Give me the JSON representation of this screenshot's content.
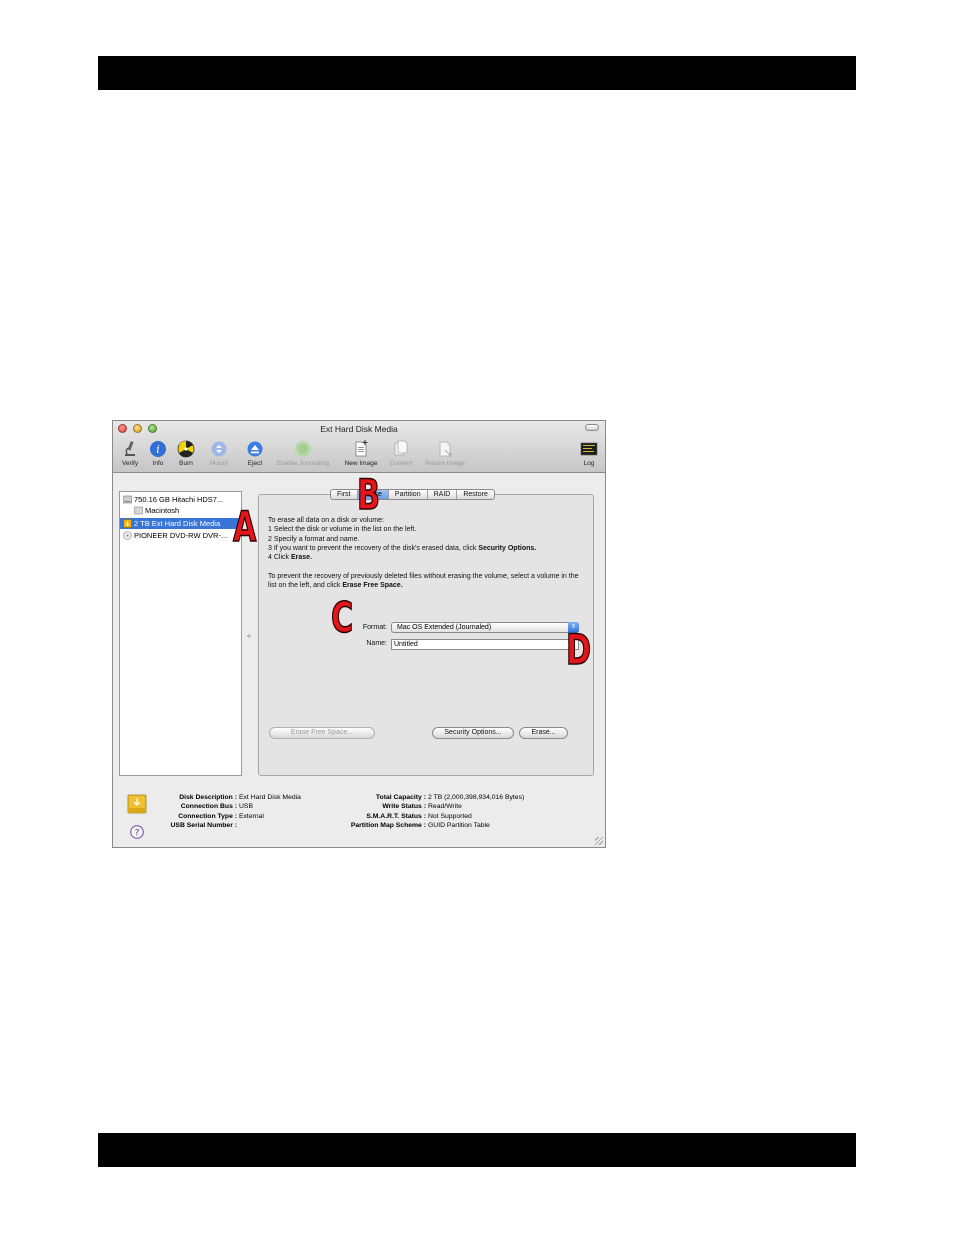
{
  "window": {
    "title": "Ext Hard Disk Media"
  },
  "toolbar": {
    "items": [
      {
        "label": "Verify",
        "icon": "microscope-icon",
        "enabled": true
      },
      {
        "label": "Info",
        "icon": "info-icon",
        "enabled": true
      },
      {
        "label": "Burn",
        "icon": "burn-icon",
        "enabled": true
      },
      {
        "label": "Mount",
        "icon": "mount-icon",
        "enabled": false
      },
      {
        "label": "Eject",
        "icon": "eject-icon",
        "enabled": true
      },
      {
        "label": "Enable Journaling",
        "icon": "journaling-icon",
        "enabled": false
      },
      {
        "label": "New Image",
        "icon": "new-image-icon",
        "enabled": true
      },
      {
        "label": "Convert",
        "icon": "convert-icon",
        "enabled": false
      },
      {
        "label": "Resize Image",
        "icon": "resize-image-icon",
        "enabled": false
      },
      {
        "label": "Log",
        "icon": "log-icon",
        "enabled": true
      }
    ]
  },
  "sidebar": {
    "items": [
      {
        "label": "750.16 GB Hitachi HDS7...",
        "icon": "hard-disk-icon",
        "selected": false
      },
      {
        "label": "Macintosh",
        "icon": "volume-icon",
        "selected": false
      },
      {
        "label": "2 TB Ext Hard Disk Media",
        "icon": "external-disk-icon",
        "selected": true
      },
      {
        "label": "PIONEER DVD-RW DVR-...",
        "icon": "optical-drive-icon",
        "selected": false
      }
    ]
  },
  "tabs": [
    {
      "label": "First",
      "active": false
    },
    {
      "label": "Erase",
      "active": true
    },
    {
      "label": "Partition",
      "active": false
    },
    {
      "label": "RAID",
      "active": false
    },
    {
      "label": "Restore",
      "active": false
    }
  ],
  "instructions": {
    "line1": "To erase all data on a disk or volume:",
    "step1": "1  Select the disk or volume in the list on the left.",
    "step2_pre": "2  Specify a format and name.",
    "step3_pre": "3  If you want to prevent the recovery of the disk's erased data, click ",
    "step3_bold": "Security Options.",
    "step4_pre": "4  Click ",
    "step4_bold": "Erase.",
    "para2_pre": "To prevent the recovery of previously deleted files without erasing the volume, select a volume in the list on the left, and click ",
    "para2_bold": "Erase Free Space."
  },
  "form": {
    "format_label": "Format:",
    "format_value": "Mac OS Extended (Journaled)",
    "name_label": "Name:",
    "name_value": "Untitled"
  },
  "buttons": {
    "erase_free_space": "Erase Free Space...",
    "security_options": "Security Options...",
    "erase": "Erase..."
  },
  "disk_info": {
    "left": [
      {
        "key": "Disk Description :",
        "value": "Ext Hard Disk Media"
      },
      {
        "key": "Connection Bus :",
        "value": "USB"
      },
      {
        "key": "Connection Type :",
        "value": "External"
      },
      {
        "key": "USB Serial Number :",
        "value": ""
      }
    ],
    "right": [
      {
        "key": "Total Capacity :",
        "value": "2 TB (2,000,398,934,016 Bytes)"
      },
      {
        "key": "Write Status :",
        "value": "Read/Write"
      },
      {
        "key": "S.M.A.R.T. Status :",
        "value": "Not Supported"
      },
      {
        "key": "Partition Map Scheme :",
        "value": "GUID Partition Table"
      }
    ]
  },
  "callouts": {
    "a": "A",
    "b": "B",
    "c": "C",
    "d": "D"
  },
  "colors": {
    "selection": "#3875d7",
    "callout_red": "#e4151b",
    "page_bar": "#000000"
  }
}
